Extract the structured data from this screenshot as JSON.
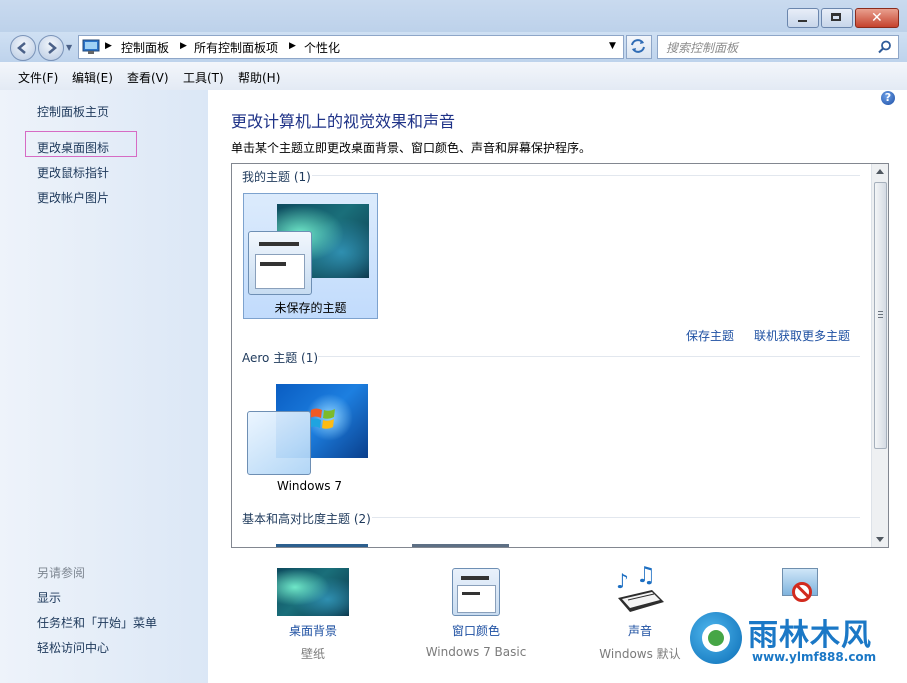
{
  "window": {
    "minimize_icon": "minimize-icon",
    "maximize_icon": "maximize-icon",
    "close_icon": "close-icon"
  },
  "navigation": {
    "breadcrumb": [
      "控制面板",
      "所有控制面板项",
      "个性化"
    ],
    "search_placeholder": "搜索控制面板"
  },
  "menu": [
    "文件(F)",
    "编辑(E)",
    "查看(V)",
    "工具(T)",
    "帮助(H)"
  ],
  "sidebar": {
    "links": [
      "控制面板主页",
      "更改桌面图标",
      "更改鼠标指针",
      "更改帐户图片"
    ],
    "see_also_label": "另请参阅",
    "see_also": [
      "显示",
      "任务栏和「开始」菜单",
      "轻松访问中心"
    ]
  },
  "main": {
    "title": "更改计算机上的视觉效果和声音",
    "description": "单击某个主题立即更改桌面背景、窗口颜色、声音和屏幕保护程序。",
    "sections": {
      "my_themes": "我的主题 (1)",
      "aero_themes": "Aero 主题 (1)",
      "basic_themes": "基本和高对比度主题 (2)"
    },
    "my_theme_name": "未保存的主题",
    "aero_theme_name": "Windows 7",
    "save_theme_link": "保存主题",
    "get_more_link": "联机获取更多主题"
  },
  "bottom": {
    "desktop_background": {
      "title": "桌面背景",
      "sub": "壁纸"
    },
    "window_color": {
      "title": "窗口颜色",
      "sub": "Windows 7 Basic"
    },
    "sounds": {
      "title": "声音",
      "sub": "Windows 默认"
    }
  },
  "watermark": {
    "name": "雨林木风",
    "url": "www.ylmf888.com"
  },
  "colors": {
    "link": "#1e50a2",
    "title": "#1e3287",
    "highlight_box": "#d66bc4"
  }
}
